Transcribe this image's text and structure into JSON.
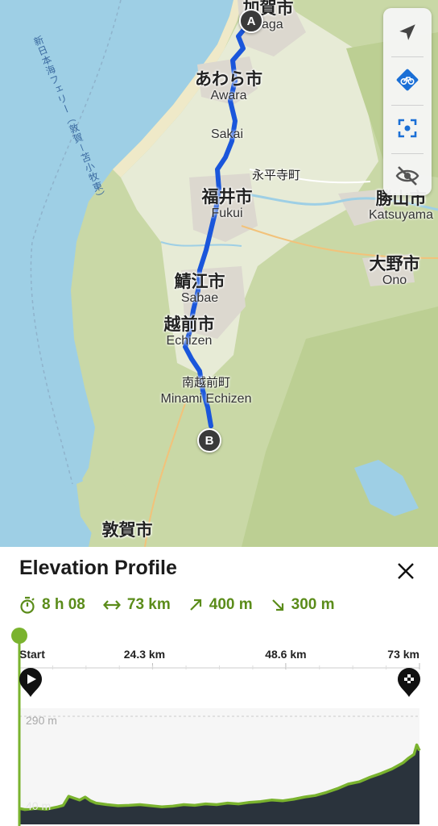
{
  "map": {
    "ferry_label": "新日本海フェリー（敦賀－苫小牧東）",
    "cities": [
      {
        "jp": "加賀市",
        "en": "Kaga"
      },
      {
        "jp": "あわら市",
        "en": "Awara"
      },
      {
        "jp": "",
        "en": "Sakai"
      },
      {
        "jp": "永平寺町",
        "en": ""
      },
      {
        "jp": "福井市",
        "en": "Fukui"
      },
      {
        "jp": "勝山市",
        "en": "Katsuyama"
      },
      {
        "jp": "大野市",
        "en": "Ono"
      },
      {
        "jp": "鯖江市",
        "en": "Sabae"
      },
      {
        "jp": "越前市",
        "en": "Echizen"
      },
      {
        "jp": "南越前町",
        "en": "Minami Echizen"
      },
      {
        "jp": "敦賀市",
        "en": ""
      }
    ],
    "start_marker": "A",
    "end_marker": "B",
    "colors": {
      "sea": "#9ed0e6",
      "land": "#e8ecd2",
      "forest": "#c8d8a4",
      "urban": "#e0dcd2",
      "route": "#1a56db"
    }
  },
  "controls": [
    {
      "icon": "navigation-arrow-icon"
    },
    {
      "icon": "bike-route-icon"
    },
    {
      "icon": "recenter-focus-icon"
    },
    {
      "icon": "hide-eye-icon"
    }
  ],
  "panel": {
    "title": "Elevation Profile",
    "close_icon": "close-icon",
    "stats": {
      "duration": "8 h 08",
      "distance": "73 km",
      "ascent": "400 m",
      "descent": "300 m"
    }
  },
  "chart_data": {
    "type": "area",
    "title": "",
    "xlabel": "",
    "ylabel": "",
    "x_ticks": [
      "Start",
      "24.3 km",
      "48.6 km",
      "73 km"
    ],
    "y_labels": [
      "290 m",
      "40 m"
    ],
    "xlim": [
      0,
      73
    ],
    "ylim": [
      40,
      290
    ],
    "series": [
      {
        "x": [
          0,
          1,
          3,
          5,
          7,
          8,
          9,
          10,
          11,
          12,
          13,
          14,
          16,
          18,
          20,
          22,
          24,
          26,
          28,
          30,
          32,
          34,
          36,
          38,
          40,
          42,
          44,
          46,
          48,
          50,
          52,
          54,
          56,
          58,
          60,
          62,
          64,
          66,
          68,
          70,
          71,
          72,
          72.5,
          73
        ],
        "y": [
          48,
          45,
          48,
          46,
          52,
          56,
          80,
          75,
          70,
          78,
          68,
          62,
          58,
          55,
          56,
          58,
          55,
          52,
          54,
          58,
          56,
          60,
          58,
          62,
          60,
          64,
          66,
          70,
          68,
          72,
          78,
          82,
          90,
          100,
          112,
          118,
          130,
          140,
          152,
          168,
          180,
          190,
          215,
          200
        ]
      }
    ],
    "grid": true,
    "colors": {
      "fill": "#2a333c",
      "line": "#7ab32e"
    }
  }
}
